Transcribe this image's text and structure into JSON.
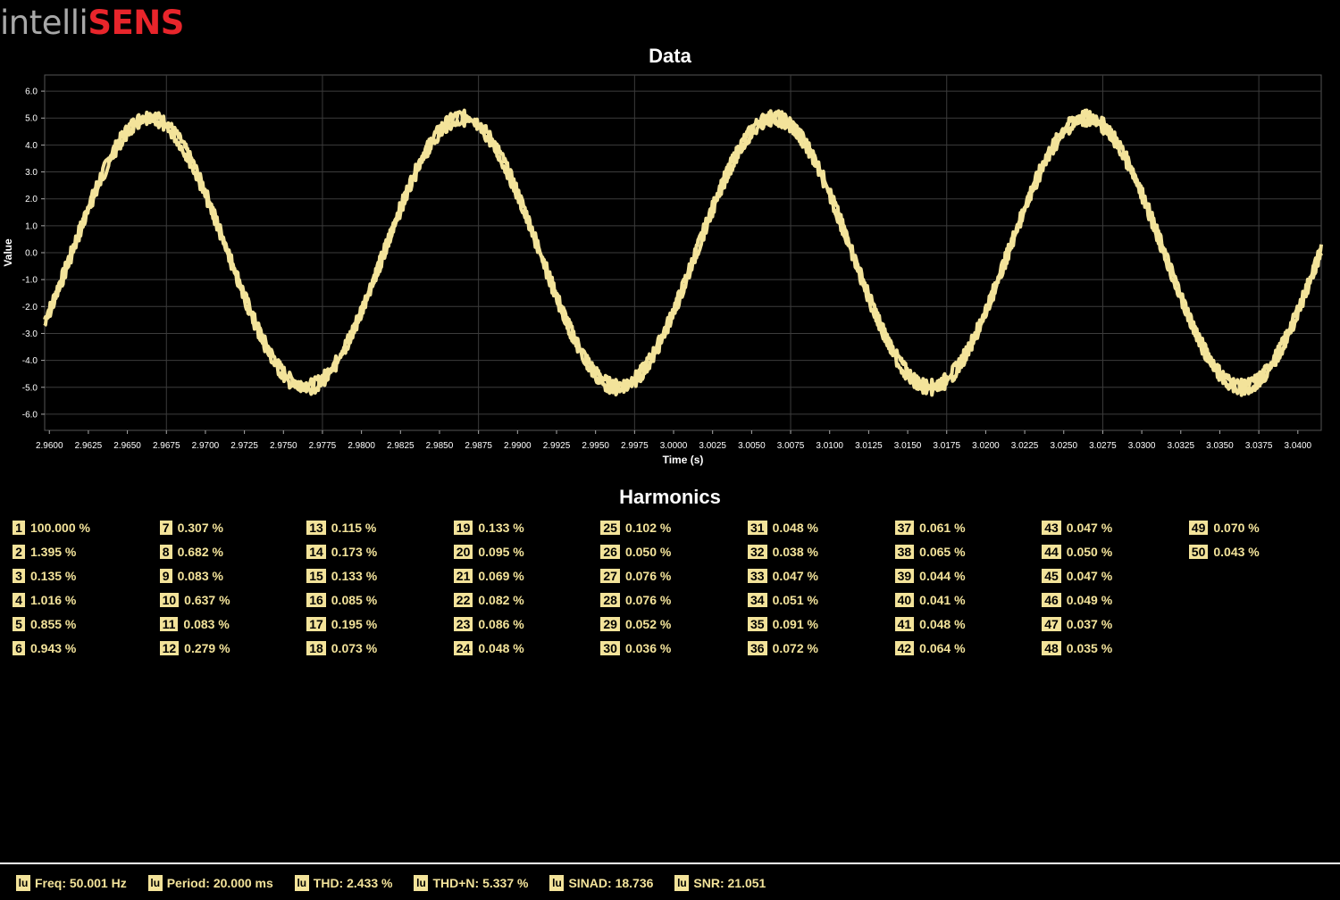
{
  "app": {
    "logo_part1": "intelli",
    "logo_part2": "SENS",
    "logo_color2": "#e8252b"
  },
  "chart_title": "Data",
  "harmonics_title": "Harmonics",
  "colors": {
    "trace": "#f3e39a",
    "grid": "#3c3c3c",
    "background": "#000000",
    "accent": "#f3e39a"
  },
  "chart_data": {
    "type": "line",
    "title": "Data",
    "xlabel": "Time (s)",
    "ylabel": "Value",
    "xlim": [
      2.9597,
      3.0415
    ],
    "ylim": [
      -6.6,
      6.6
    ],
    "grid": true,
    "legend": "none",
    "x_ticks": [
      "2.9600",
      "2.9625",
      "2.9650",
      "2.9675",
      "2.9700",
      "2.9725",
      "2.9750",
      "2.9775",
      "2.9800",
      "2.9825",
      "2.9850",
      "2.9875",
      "2.9900",
      "2.9925",
      "2.9950",
      "2.9975",
      "3.0000",
      "3.0025",
      "3.0050",
      "3.0075",
      "3.0100",
      "3.0125",
      "3.0150",
      "3.0175",
      "3.0200",
      "3.0225",
      "3.0250",
      "3.0275",
      "3.0300",
      "3.0325",
      "3.0350",
      "3.0375",
      "3.0400"
    ],
    "y_ticks": [
      "6.0",
      "5.0",
      "4.0",
      "3.0",
      "2.0",
      "1.0",
      "0.0",
      "-1.0",
      "-2.0",
      "-3.0",
      "-4.0",
      "-5.0",
      "-6.0"
    ],
    "series": [
      {
        "frequency_hz": 50.001,
        "amplitude": 5.0,
        "x": [
          2.9597,
          2.9617,
          2.9637,
          2.9657,
          2.9667,
          2.9677,
          2.9697,
          2.9717,
          2.9737,
          2.9757,
          2.9767,
          2.9777,
          2.9797,
          2.9817,
          2.9837,
          2.9857,
          2.9867,
          2.9877,
          2.9897,
          2.9917,
          2.9937,
          2.9957,
          2.9967,
          2.9977,
          2.9997,
          3.0017,
          3.0037,
          3.0057,
          3.0067,
          3.0077,
          3.0097,
          3.0117,
          3.0137,
          3.0157,
          3.0167,
          3.0177,
          3.0197,
          3.0217,
          3.0237,
          3.0257,
          3.0267,
          3.0277,
          3.0297,
          3.0317,
          3.0337,
          3.0357,
          3.0367,
          3.0377,
          3.0397,
          3.0415
        ],
        "y": [
          -2.6,
          0.3,
          2.8,
          4.6,
          5.0,
          4.6,
          2.6,
          -0.1,
          -2.9,
          -4.7,
          -5.0,
          -4.6,
          -2.5,
          0.2,
          2.9,
          4.7,
          5.0,
          4.5,
          2.5,
          -0.2,
          -3.0,
          -4.8,
          -5.0,
          -4.5,
          -2.4,
          0.3,
          3.0,
          4.8,
          5.0,
          4.5,
          2.4,
          -0.3,
          -3.1,
          -4.8,
          -5.0,
          -4.4,
          -2.3,
          0.4,
          3.1,
          4.8,
          5.0,
          4.4,
          2.3,
          -0.4,
          -3.2,
          -4.8,
          -5.0,
          -4.4,
          -2.2,
          1.1
        ]
      }
    ]
  },
  "harmonics": [
    {
      "n": "1",
      "v": "100.000 %"
    },
    {
      "n": "2",
      "v": "1.395 %"
    },
    {
      "n": "3",
      "v": "0.135 %"
    },
    {
      "n": "4",
      "v": "1.016 %"
    },
    {
      "n": "5",
      "v": "0.855 %"
    },
    {
      "n": "6",
      "v": "0.943 %"
    },
    {
      "n": "7",
      "v": "0.307 %"
    },
    {
      "n": "8",
      "v": "0.682 %"
    },
    {
      "n": "9",
      "v": "0.083 %"
    },
    {
      "n": "10",
      "v": "0.637 %"
    },
    {
      "n": "11",
      "v": "0.083 %"
    },
    {
      "n": "12",
      "v": "0.279 %"
    },
    {
      "n": "13",
      "v": "0.115 %"
    },
    {
      "n": "14",
      "v": "0.173 %"
    },
    {
      "n": "15",
      "v": "0.133 %"
    },
    {
      "n": "16",
      "v": "0.085 %"
    },
    {
      "n": "17",
      "v": "0.195 %"
    },
    {
      "n": "18",
      "v": "0.073 %"
    },
    {
      "n": "19",
      "v": "0.133 %"
    },
    {
      "n": "20",
      "v": "0.095 %"
    },
    {
      "n": "21",
      "v": "0.069 %"
    },
    {
      "n": "22",
      "v": "0.082 %"
    },
    {
      "n": "23",
      "v": "0.086 %"
    },
    {
      "n": "24",
      "v": "0.048 %"
    },
    {
      "n": "25",
      "v": "0.102 %"
    },
    {
      "n": "26",
      "v": "0.050 %"
    },
    {
      "n": "27",
      "v": "0.076 %"
    },
    {
      "n": "28",
      "v": "0.076 %"
    },
    {
      "n": "29",
      "v": "0.052 %"
    },
    {
      "n": "30",
      "v": "0.036 %"
    },
    {
      "n": "31",
      "v": "0.048 %"
    },
    {
      "n": "32",
      "v": "0.038 %"
    },
    {
      "n": "33",
      "v": "0.047 %"
    },
    {
      "n": "34",
      "v": "0.051 %"
    },
    {
      "n": "35",
      "v": "0.091 %"
    },
    {
      "n": "36",
      "v": "0.072 %"
    },
    {
      "n": "37",
      "v": "0.061 %"
    },
    {
      "n": "38",
      "v": "0.065 %"
    },
    {
      "n": "39",
      "v": "0.044 %"
    },
    {
      "n": "40",
      "v": "0.041 %"
    },
    {
      "n": "41",
      "v": "0.048 %"
    },
    {
      "n": "42",
      "v": "0.064 %"
    },
    {
      "n": "43",
      "v": "0.047 %"
    },
    {
      "n": "44",
      "v": "0.050 %"
    },
    {
      "n": "45",
      "v": "0.047 %"
    },
    {
      "n": "46",
      "v": "0.049 %"
    },
    {
      "n": "47",
      "v": "0.037 %"
    },
    {
      "n": "48",
      "v": "0.035 %"
    },
    {
      "n": "49",
      "v": "0.070 %"
    },
    {
      "n": "50",
      "v": "0.043 %"
    }
  ],
  "footer": {
    "icon_label": "lu",
    "stats": [
      {
        "name": "freq",
        "text": "Freq: 50.001 Hz"
      },
      {
        "name": "period",
        "text": "Period: 20.000 ms"
      },
      {
        "name": "thd",
        "text": "THD: 2.433 %"
      },
      {
        "name": "thdn",
        "text": "THD+N: 5.337 %"
      },
      {
        "name": "sinad",
        "text": "SINAD: 18.736"
      },
      {
        "name": "snr",
        "text": "SNR: 21.051"
      }
    ]
  }
}
